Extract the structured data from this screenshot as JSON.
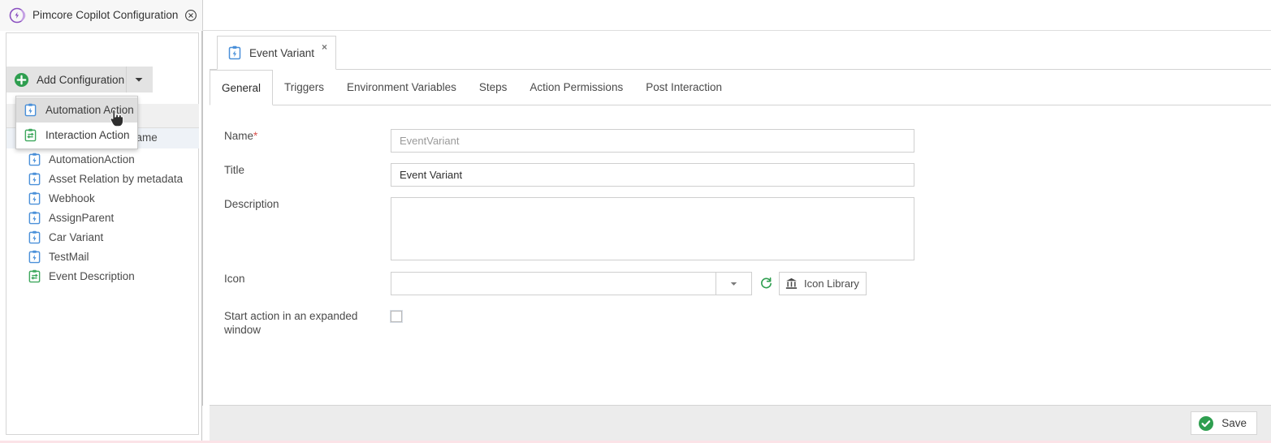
{
  "window": {
    "title": "Pimcore Copilot Configuration",
    "logo_icon": "pimcore-logo-icon",
    "close_icon": "close-circle-icon"
  },
  "left_panel": {
    "add_button": {
      "label": "Add Configuration",
      "plus_icon": "plus-circle-icon",
      "caret_icon": "chevron-down-icon"
    },
    "dropdown": {
      "items": [
        {
          "label": "Automation Action",
          "icon": "clipboard-bolt-icon",
          "active": true
        },
        {
          "label": "Interaction Action",
          "icon": "clipboard-exchange-icon",
          "active": false
        }
      ]
    },
    "grid": {
      "column_header": "name",
      "rows": [
        {
          "label": "AutomationAction",
          "icon": "clipboard-bolt-icon"
        },
        {
          "label": "Asset Relation by metadata",
          "icon": "clipboard-bolt-icon"
        },
        {
          "label": "Webhook",
          "icon": "clipboard-bolt-icon"
        },
        {
          "label": "AssignParent",
          "icon": "clipboard-bolt-icon"
        },
        {
          "label": "Car Variant",
          "icon": "clipboard-bolt-icon"
        },
        {
          "label": "TestMail",
          "icon": "clipboard-bolt-icon"
        },
        {
          "label": "Event Description",
          "icon": "clipboard-exchange-icon"
        }
      ]
    }
  },
  "document_tab": {
    "title": "Event Variant",
    "icon": "clipboard-bolt-icon",
    "close_label": "×"
  },
  "subtabs": [
    {
      "label": "General",
      "active": true
    },
    {
      "label": "Triggers",
      "active": false
    },
    {
      "label": "Environment Variables",
      "active": false
    },
    {
      "label": "Steps",
      "active": false
    },
    {
      "label": "Action Permissions",
      "active": false
    },
    {
      "label": "Post Interaction",
      "active": false
    }
  ],
  "form": {
    "name": {
      "label": "Name",
      "required_marker": "*",
      "value": "EventVariant",
      "placeholder": "EventVariant"
    },
    "title": {
      "label": "Title",
      "value": "Event Variant",
      "placeholder": ""
    },
    "description": {
      "label": "Description",
      "value": "",
      "placeholder": ""
    },
    "icon": {
      "label": "Icon",
      "value": "",
      "placeholder": "",
      "trigger_icon": "chevron-down-icon",
      "refresh_icon": "refresh-icon",
      "library_icon": "bank-icon",
      "library_label": "Icon Library"
    },
    "expanded_window": {
      "label": "Start action in an expanded window",
      "checked": false
    }
  },
  "toolbar": {
    "save_label": "Save",
    "save_icon": "check-circle-icon"
  },
  "colors": {
    "accent_green": "#3aa345",
    "accent_blue": "#5b9bd5",
    "purple": "#8a4fc0",
    "required_red": "#d9534f",
    "toolbar_bg": "#ececec"
  }
}
